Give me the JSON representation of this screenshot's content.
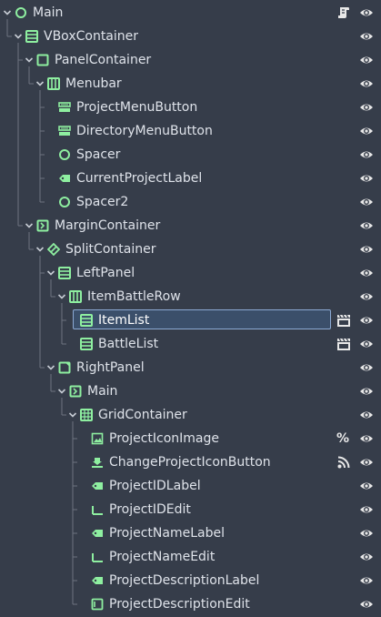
{
  "colors": {
    "background": "#363d4a",
    "selection": "#3b4f6a",
    "node_green": "#8eefa0",
    "guide": "#6d7380",
    "text": "#dfe3ea"
  },
  "tree": [
    {
      "label": "Main",
      "depth": 0,
      "icon": "control-circle-icon",
      "expanded": true,
      "right_icon": "script-icon"
    },
    {
      "label": "VBoxContainer",
      "depth": 1,
      "icon": "vbox-container-icon",
      "expanded": true
    },
    {
      "label": "PanelContainer",
      "depth": 2,
      "icon": "panel-container-icon",
      "expanded": true
    },
    {
      "label": "Menubar",
      "depth": 3,
      "icon": "hbox-container-icon",
      "expanded": true
    },
    {
      "label": "ProjectMenuButton",
      "depth": 4,
      "icon": "menu-button-icon"
    },
    {
      "label": "DirectoryMenuButton",
      "depth": 4,
      "icon": "menu-button-icon"
    },
    {
      "label": "Spacer",
      "depth": 4,
      "icon": "control-circle-icon"
    },
    {
      "label": "CurrentProjectLabel",
      "depth": 4,
      "icon": "label-icon"
    },
    {
      "label": "Spacer2",
      "depth": 4,
      "icon": "control-circle-icon"
    },
    {
      "label": "MarginContainer",
      "depth": 2,
      "icon": "margin-container-icon",
      "expanded": true
    },
    {
      "label": "SplitContainer",
      "depth": 3,
      "icon": "split-container-icon",
      "expanded": true
    },
    {
      "label": "LeftPanel",
      "depth": 4,
      "icon": "vbox-container-icon",
      "expanded": true
    },
    {
      "label": "ItemBattleRow",
      "depth": 5,
      "icon": "hbox-container-icon",
      "expanded": true
    },
    {
      "label": "ItemList",
      "depth": 6,
      "icon": "item-list-icon",
      "selected": true,
      "right_icon": "clapperboard-icon"
    },
    {
      "label": "BattleList",
      "depth": 6,
      "icon": "item-list-icon",
      "right_icon": "clapperboard-icon"
    },
    {
      "label": "RightPanel",
      "depth": 4,
      "icon": "panel-icon",
      "expanded": true
    },
    {
      "label": "Main",
      "depth": 5,
      "icon": "margin-container-icon",
      "expanded": true
    },
    {
      "label": "GridContainer",
      "depth": 6,
      "icon": "grid-container-icon",
      "expanded": true
    },
    {
      "label": "ProjectIconImage",
      "depth": 7,
      "icon": "texture-rect-icon",
      "right_icon": "percent-icon",
      "right_text": "%"
    },
    {
      "label": "ChangeProjectIconButton",
      "depth": 7,
      "icon": "button-icon",
      "right_icon": "signal-icon"
    },
    {
      "label": "ProjectIDLabel",
      "depth": 7,
      "icon": "label-icon"
    },
    {
      "label": "ProjectIDEdit",
      "depth": 7,
      "icon": "line-edit-icon"
    },
    {
      "label": "ProjectNameLabel",
      "depth": 7,
      "icon": "label-icon"
    },
    {
      "label": "ProjectNameEdit",
      "depth": 7,
      "icon": "line-edit-icon"
    },
    {
      "label": "ProjectDescriptionLabel",
      "depth": 7,
      "icon": "label-icon"
    },
    {
      "label": "ProjectDescriptionEdit",
      "depth": 7,
      "icon": "text-edit-icon"
    }
  ]
}
